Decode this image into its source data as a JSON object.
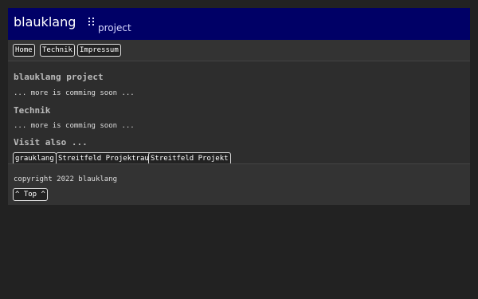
{
  "header": {
    "brand": "blauklang",
    "grip_icon": "drag-grip-icon",
    "subtitle": "project"
  },
  "nav": {
    "home": "Home",
    "technik": "Technik",
    "impressum": "Impressum"
  },
  "sections": [
    {
      "title": "blauklang project",
      "text": "... more is comming soon ..."
    },
    {
      "title": "Technik",
      "text": "... more is comming soon ..."
    }
  ],
  "visit": {
    "title": "Visit also ...",
    "links": [
      "grauklang",
      "Streitfeld Projektraum",
      "Streitfeld Projekt"
    ]
  },
  "footer": {
    "copyright": "copyright 2022 blauklang",
    "top": "^ Top ^"
  },
  "colors": {
    "header_bg": "#000066",
    "page_bg": "#222222",
    "panel_bg": "#2d2d2d"
  }
}
